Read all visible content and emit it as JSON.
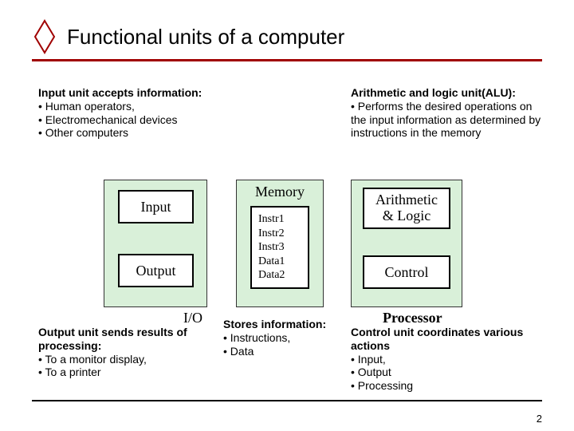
{
  "title": "Functional units of a computer",
  "page_number": "2",
  "notes": {
    "input": {
      "heading": "Input unit accepts information:",
      "items": [
        "Human operators,",
        "Electromechanical devices",
        "Other computers"
      ]
    },
    "alu": {
      "heading": "Arithmetic and logic unit(ALU):",
      "items": [
        "Performs the desired operations on the input information as determined by instructions in the memory"
      ]
    },
    "output": {
      "heading": "Output unit sends results of processing:",
      "items": [
        "To a monitor display,",
        "To a printer"
      ]
    },
    "control": {
      "heading": "Control unit coordinates various actions",
      "items": [
        "Input,",
        "Output",
        "Processing"
      ]
    },
    "memory_note": {
      "heading": "Stores information:",
      "items": [
        "Instructions,",
        "Data"
      ]
    }
  },
  "diagram": {
    "io": {
      "label": "I/O",
      "input": "Input",
      "output": "Output"
    },
    "memory": {
      "title": "Memory",
      "contents": [
        "Instr1",
        "Instr2",
        "Instr3",
        "Data1",
        "Data2"
      ]
    },
    "processor": {
      "label": "Processor",
      "alu": "Arithmetic\n& Logic",
      "control": "Control"
    }
  }
}
